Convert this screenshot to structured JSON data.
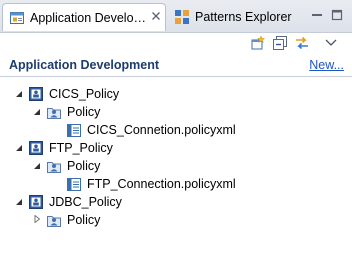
{
  "tabs": [
    {
      "label": "Application Develo…",
      "icon": "app-dev-view-icon",
      "active": true
    },
    {
      "label": "Patterns Explorer",
      "icon": "patterns-explorer-icon",
      "active": false
    }
  ],
  "toolbar": {
    "icons": [
      "add-resource-icon",
      "collapse-all-icon",
      "sync-link-icon",
      "view-menu-chevron-icon"
    ]
  },
  "section": {
    "title": "Application Development",
    "new_link": "New..."
  },
  "tree": [
    {
      "label": "CICS_Policy",
      "level": 0,
      "expanded": true,
      "icon": "policy-project-icon"
    },
    {
      "label": "Policy",
      "level": 1,
      "expanded": true,
      "icon": "policy-folder-icon"
    },
    {
      "label": "CICS_Connetion.policyxml",
      "level": 2,
      "expanded": null,
      "icon": "policy-file-icon"
    },
    {
      "label": "FTP_Policy",
      "level": 0,
      "expanded": true,
      "icon": "policy-project-icon"
    },
    {
      "label": "Policy",
      "level": 1,
      "expanded": true,
      "icon": "policy-folder-icon"
    },
    {
      "label": "FTP_Connection.policyxml",
      "level": 2,
      "expanded": null,
      "icon": "policy-file-icon"
    },
    {
      "label": "JDBC_Policy",
      "level": 0,
      "expanded": true,
      "icon": "policy-project-icon"
    },
    {
      "label": "Policy",
      "level": 1,
      "expanded": false,
      "icon": "policy-folder-icon"
    }
  ]
}
